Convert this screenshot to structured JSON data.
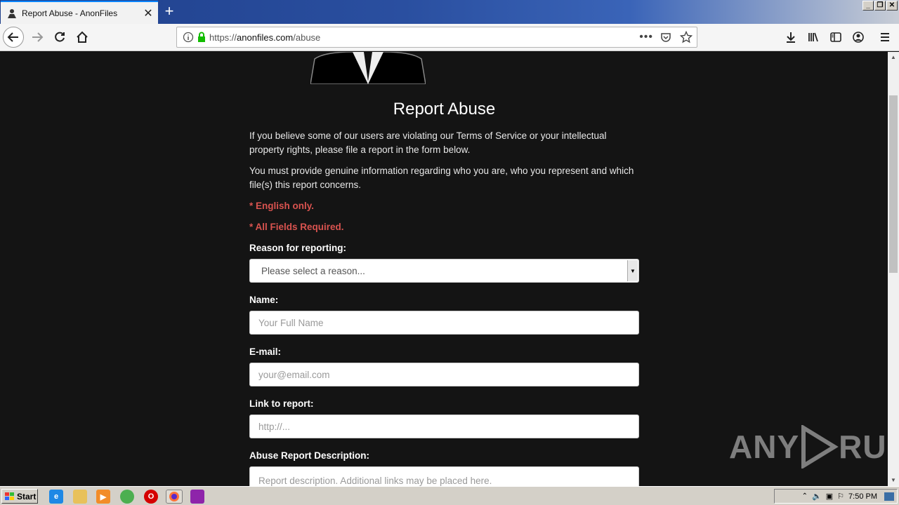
{
  "browser": {
    "tab_title": "Report Abuse - AnonFiles",
    "tab_close": "✕",
    "new_tab": "+",
    "url_prefix": "https://",
    "url_domain": "anonfiles.com",
    "url_path": "/abuse",
    "window_buttons": [
      "_",
      "❐",
      "✕"
    ]
  },
  "page": {
    "heading": "Report Abuse",
    "intro_1": "If you believe some of our users are violating our Terms of Service or your intellectual property rights, please file a report in the form below.",
    "intro_2": "You must provide genuine information regarding who you are, who you represent and which file(s) this report concerns.",
    "warning_english": "* English only.",
    "warning_required": "* All Fields Required.",
    "form": {
      "reason_label": "Reason for reporting:",
      "reason_selected": "Please select a reason...",
      "name_label": "Name:",
      "name_placeholder": "Your Full Name",
      "email_label": "E-mail:",
      "email_placeholder": "your@email.com",
      "link_label": "Link to report:",
      "link_placeholder": "http://...",
      "description_label": "Abuse Report Description:",
      "description_placeholder": "Report description. Additional links may be placed here."
    }
  },
  "watermark": {
    "left": "ANY",
    "right": "RUN"
  },
  "taskbar": {
    "start_label": "Start",
    "clock": "7:50 PM"
  },
  "colors": {
    "accent": "#0a84ff",
    "warning": "#d9534f",
    "page_bg": "#141414"
  }
}
